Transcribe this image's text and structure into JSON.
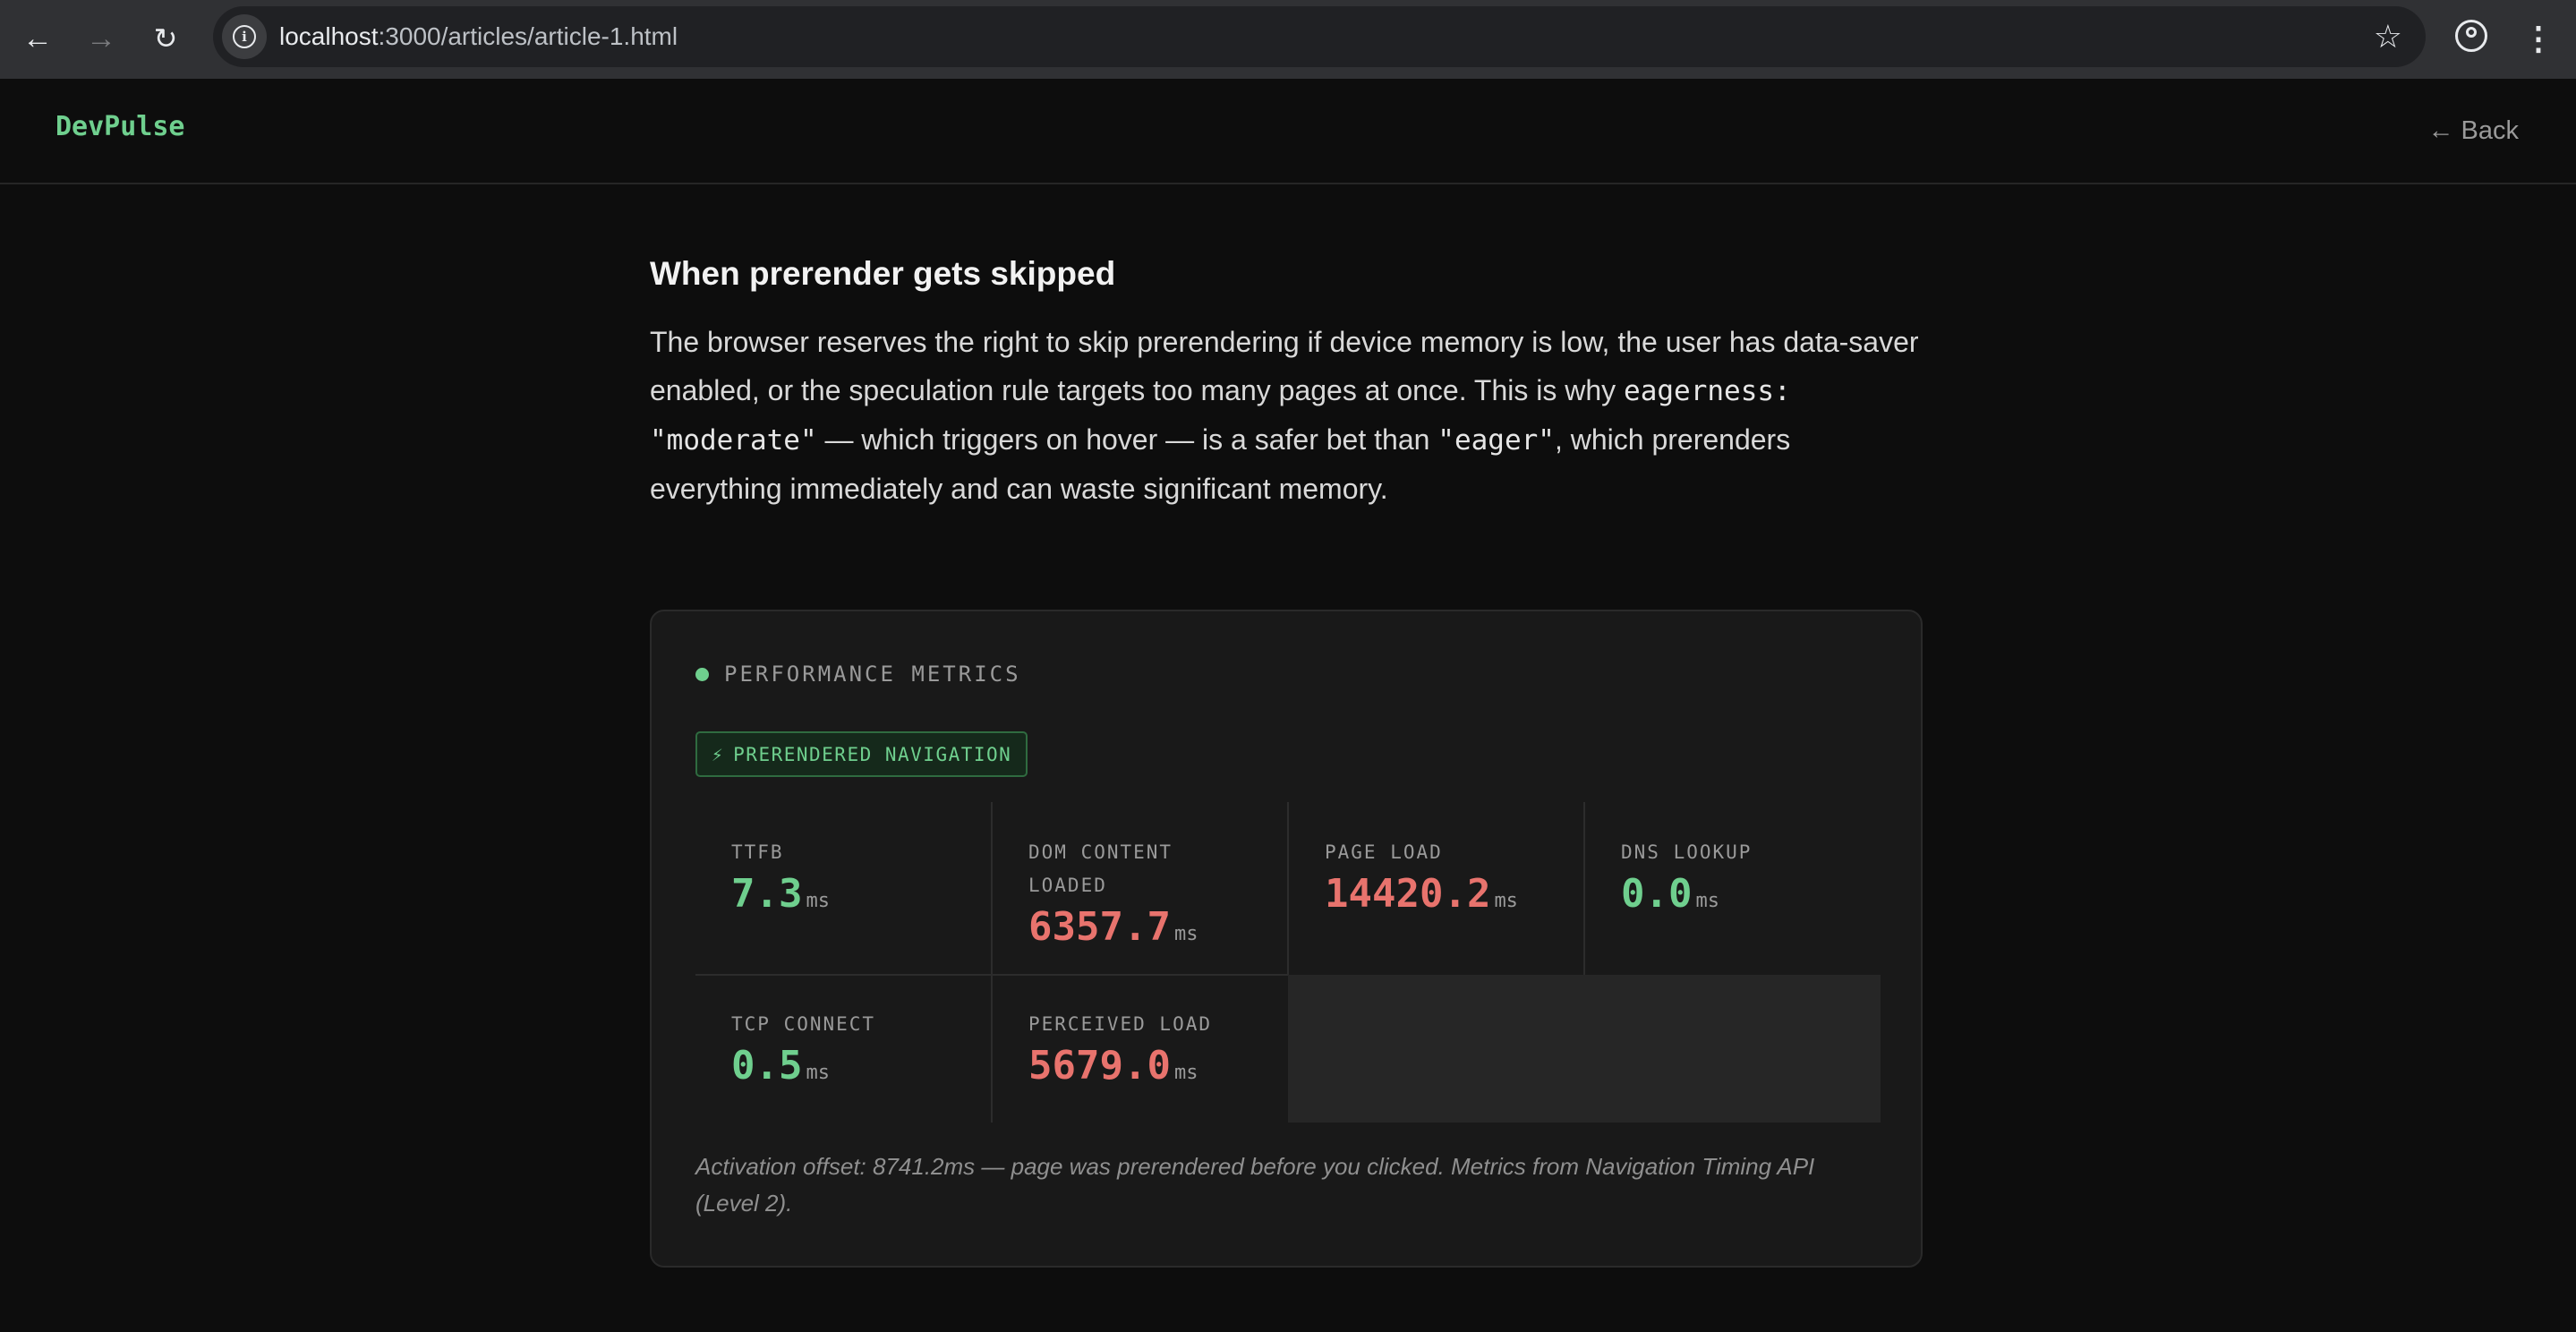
{
  "browser": {
    "url_host": "localhost",
    "url_path": ":3000/articles/article-1.html",
    "back_icon": "arrow-left-icon",
    "forward_icon": "arrow-right-icon",
    "reload_icon": "reload-icon",
    "star_icon": "star-icon"
  },
  "site": {
    "brand": "DevPulse",
    "back_link": "← Back"
  },
  "article": {
    "partial_line": "…   ·   …",
    "heading": "When prerender gets skipped",
    "para_text_1": "The browser reserves the right to skip prerendering if device memory is low, the user has data-saver enabled, or the speculation rule targets too many pages at once. This is why ",
    "code_1": "eagerness: \"moderate\"",
    "para_text_2": " — which triggers on hover — is a safer bet than ",
    "code_2": "\"eager\"",
    "para_text_3": ", which prerenders everything immediately and can waste significant memory."
  },
  "metrics": {
    "title": "PERFORMANCE METRICS",
    "badge_icon": "⚡",
    "badge": "PRERENDERED NAVIGATION",
    "items": [
      {
        "label": "TTFB",
        "value": "7.3",
        "unit": "ms",
        "status": "good"
      },
      {
        "label": "DOM CONTENT LOADED",
        "value": "6357.7",
        "unit": "ms",
        "status": "bad"
      },
      {
        "label": "PAGE LOAD",
        "value": "14420.2",
        "unit": "ms",
        "status": "bad"
      },
      {
        "label": "DNS LOOKUP",
        "value": "0.0",
        "unit": "ms",
        "status": "good"
      },
      {
        "label": "TCP CONNECT",
        "value": "0.5",
        "unit": "ms",
        "status": "good"
      },
      {
        "label": "PERCEIVED LOAD",
        "value": "5679.0",
        "unit": "ms",
        "status": "bad"
      }
    ],
    "note": "Activation offset: 8741.2ms — page was prerendered before you clicked. Metrics from Navigation Timing API (Level 2)."
  },
  "colors": {
    "good": "#6fcf8e",
    "bad": "#e8736d",
    "background": "#0d0d0d",
    "card": "#191919"
  }
}
